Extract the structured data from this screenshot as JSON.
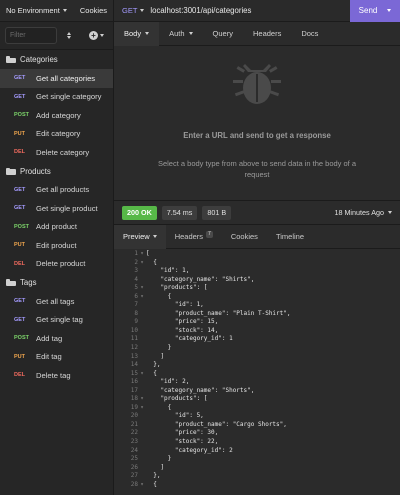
{
  "sidebar": {
    "environment": "No Environment",
    "cookies": "Cookies",
    "filter_placeholder": "Filter",
    "folders": [
      {
        "name": "Categories",
        "requests": [
          {
            "method": "GET",
            "label": "Get all categories",
            "active": true
          },
          {
            "method": "GET",
            "label": "Get single category"
          },
          {
            "method": "POST",
            "label": "Add category"
          },
          {
            "method": "PUT",
            "label": "Edit category"
          },
          {
            "method": "DEL",
            "label": "Delete category"
          }
        ]
      },
      {
        "name": "Products",
        "requests": [
          {
            "method": "GET",
            "label": "Get all products"
          },
          {
            "method": "GET",
            "label": "Get single product"
          },
          {
            "method": "POST",
            "label": "Add product"
          },
          {
            "method": "PUT",
            "label": "Edit product"
          },
          {
            "method": "DEL",
            "label": "Delete product"
          }
        ]
      },
      {
        "name": "Tags",
        "requests": [
          {
            "method": "GET",
            "label": "Get all tags"
          },
          {
            "method": "GET",
            "label": "Get single tag"
          },
          {
            "method": "POST",
            "label": "Add tag"
          },
          {
            "method": "PUT",
            "label": "Edit tag"
          },
          {
            "method": "DEL",
            "label": "Delete tag"
          }
        ]
      }
    ]
  },
  "request": {
    "method": "GET",
    "url": "localhost:3001/api/categories",
    "send_label": "Send",
    "tabs": [
      "Body",
      "Auth",
      "Query",
      "Headers",
      "Docs"
    ],
    "placeholder_title": "Enter a URL and send to get a response",
    "placeholder_sub": "Select a body type from above to send data in the body of a request"
  },
  "response": {
    "status": "200 OK",
    "time": "7.54 ms",
    "size": "801 B",
    "ago": "18 Minutes Ago",
    "tabs": [
      "Preview",
      "Headers",
      "Cookies",
      "Timeline"
    ],
    "headers_count": "7",
    "lines": [
      {
        "n": "1",
        "f": "▾",
        "t": "["
      },
      {
        "n": "2",
        "f": "▾",
        "t": "  {"
      },
      {
        "n": "3",
        "f": "",
        "t": "    \"id\": 1,"
      },
      {
        "n": "4",
        "f": "",
        "t": "    \"category_name\": \"Shirts\","
      },
      {
        "n": "5",
        "f": "▾",
        "t": "    \"products\": ["
      },
      {
        "n": "6",
        "f": "▾",
        "t": "      {"
      },
      {
        "n": "7",
        "f": "",
        "t": "        \"id\": 1,"
      },
      {
        "n": "8",
        "f": "",
        "t": "        \"product_name\": \"Plain T-Shirt\","
      },
      {
        "n": "9",
        "f": "",
        "t": "        \"price\": 15,"
      },
      {
        "n": "10",
        "f": "",
        "t": "        \"stock\": 14,"
      },
      {
        "n": "11",
        "f": "",
        "t": "        \"category_id\": 1"
      },
      {
        "n": "12",
        "f": "",
        "t": "      }"
      },
      {
        "n": "13",
        "f": "",
        "t": "    ]"
      },
      {
        "n": "14",
        "f": "",
        "t": "  },"
      },
      {
        "n": "15",
        "f": "▾",
        "t": "  {"
      },
      {
        "n": "16",
        "f": "",
        "t": "    \"id\": 2,"
      },
      {
        "n": "17",
        "f": "",
        "t": "    \"category_name\": \"Shorts\","
      },
      {
        "n": "18",
        "f": "▾",
        "t": "    \"products\": ["
      },
      {
        "n": "19",
        "f": "▾",
        "t": "      {"
      },
      {
        "n": "20",
        "f": "",
        "t": "        \"id\": 5,"
      },
      {
        "n": "21",
        "f": "",
        "t": "        \"product_name\": \"Cargo Shorts\","
      },
      {
        "n": "22",
        "f": "",
        "t": "        \"price\": 30,"
      },
      {
        "n": "23",
        "f": "",
        "t": "        \"stock\": 22,"
      },
      {
        "n": "24",
        "f": "",
        "t": "        \"category_id\": 2"
      },
      {
        "n": "25",
        "f": "",
        "t": "      }"
      },
      {
        "n": "26",
        "f": "",
        "t": "    ]"
      },
      {
        "n": "27",
        "f": "",
        "t": "  },"
      },
      {
        "n": "28",
        "f": "▾",
        "t": "  {"
      }
    ]
  },
  "colors": {
    "accent": "#7b68d6",
    "get": "#a59bff",
    "post": "#7cd46a",
    "put": "#f0a64e",
    "del": "#f06a5e",
    "ok": "#57b848"
  }
}
